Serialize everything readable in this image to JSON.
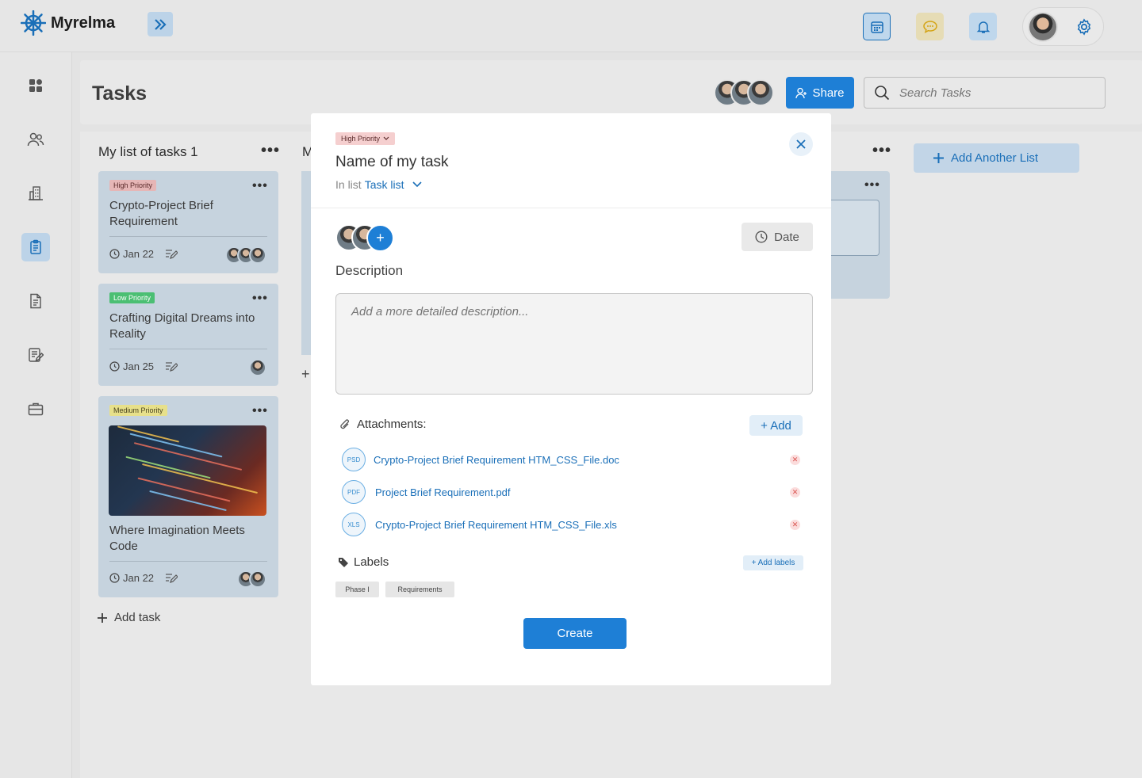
{
  "app": {
    "name": "Myrelma"
  },
  "header": {
    "title": "Tasks",
    "share_label": "Share",
    "search_placeholder": "Search Tasks"
  },
  "lists": [
    {
      "title": "My list of tasks 1",
      "cards": [
        {
          "priority": "High Priority",
          "title": "Crypto-Project Brief Requirement",
          "date": "Jan 22"
        },
        {
          "priority": "Low Priority",
          "title": "Crafting Digital Dreams into Reality",
          "date": "Jan 25"
        },
        {
          "priority": "Medium Priority",
          "title": "Where Imagination Meets Code",
          "date": "Jan 22"
        }
      ],
      "add_task_label": "Add task"
    },
    {
      "title": "M"
    }
  ],
  "add_list_label": "Add Another List",
  "modal": {
    "priority": "High Priority",
    "title": "Name of my task",
    "in_list_prefix": "In list",
    "list_name": "Task list",
    "date_label": "Date",
    "description_label": "Description",
    "description_placeholder": "Add a more detailed description...",
    "attachments_label": "Attachments:",
    "add_attachment_label": "+ Add",
    "attachments": [
      {
        "type": "PSD",
        "name": "Crypto-Project Brief Requirement HTM_CSS_File.doc"
      },
      {
        "type": "PDF",
        "name": "Project Brief Requirement.pdf"
      },
      {
        "type": "XLS",
        "name": "Crypto-Project Brief Requirement HTM_CSS_File.xls"
      }
    ],
    "labels_label": "Labels",
    "add_labels_label": "+ Add labels",
    "labels": [
      "Phase I",
      "Requirements"
    ],
    "create_label": "Create"
  },
  "colors": {
    "accent": "#1e7fd6",
    "card": "#c6d3de"
  }
}
